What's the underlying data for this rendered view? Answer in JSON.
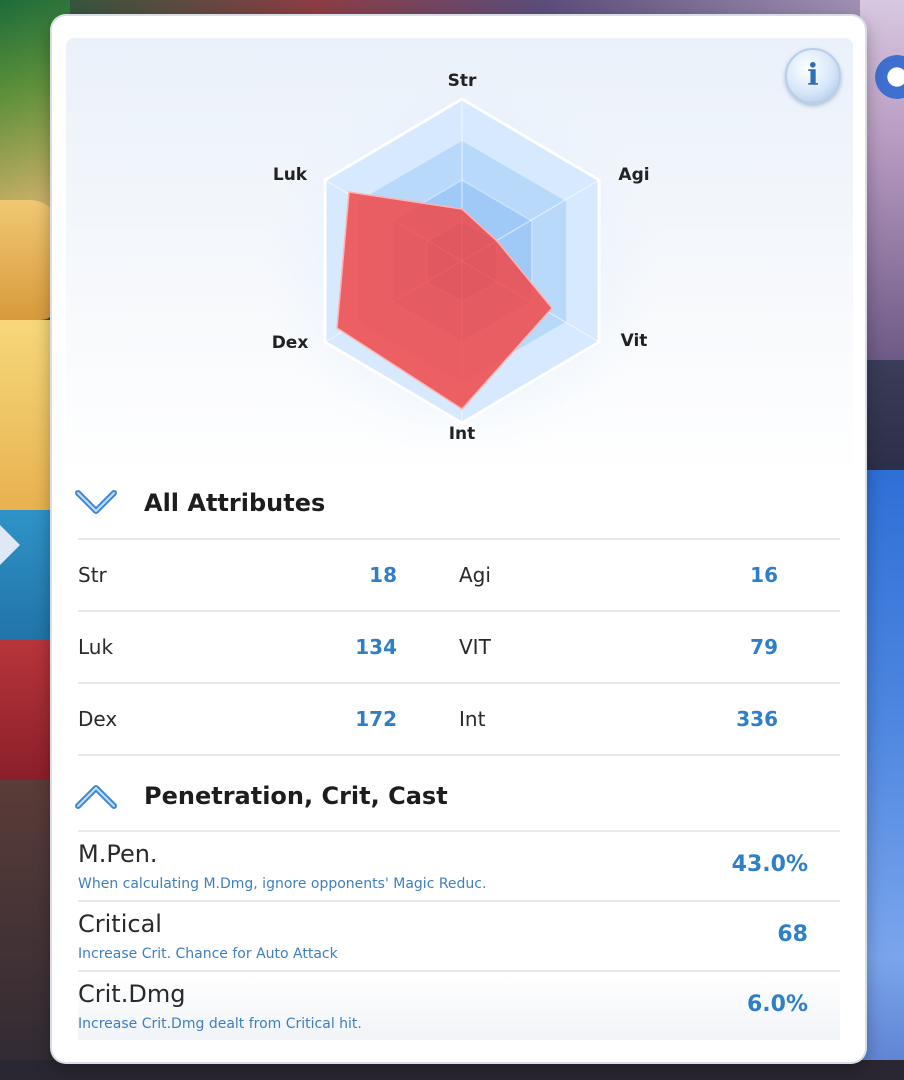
{
  "radar": {
    "labels": [
      "Str",
      "Agi",
      "Vit",
      "Int",
      "Dex",
      "Luk"
    ],
    "fill_color": "#f04848",
    "grid_color": "#a9cdf7"
  },
  "info_button": {
    "icon": "info-icon"
  },
  "sections": {
    "attributes": {
      "title": "All Attributes",
      "icon": "chevron-down-icon",
      "rows": [
        [
          {
            "name": "Str",
            "value": "18"
          },
          {
            "name": "Agi",
            "value": "16"
          }
        ],
        [
          {
            "name": "Luk",
            "value": "134"
          },
          {
            "name": "VIT",
            "value": "79"
          }
        ],
        [
          {
            "name": "Dex",
            "value": "172"
          },
          {
            "name": "Int",
            "value": "336"
          }
        ]
      ]
    },
    "penetration": {
      "title": "Penetration, Crit, Cast",
      "icon": "chevron-up-icon",
      "rows": [
        {
          "name": "M.Pen.",
          "desc": "When calculating M.Dmg, ignore opponents' Magic Reduc.",
          "value": "43.0%"
        },
        {
          "name": "Critical",
          "desc": "Increase Crit. Chance for Auto Attack",
          "value": "68"
        },
        {
          "name": "Crit.Dmg",
          "desc": "Increase Crit.Dmg dealt from Critical hit.",
          "value": "6.0%"
        }
      ]
    }
  },
  "colors": {
    "accent": "#2f7fc8",
    "text": "#2a2a2a"
  }
}
